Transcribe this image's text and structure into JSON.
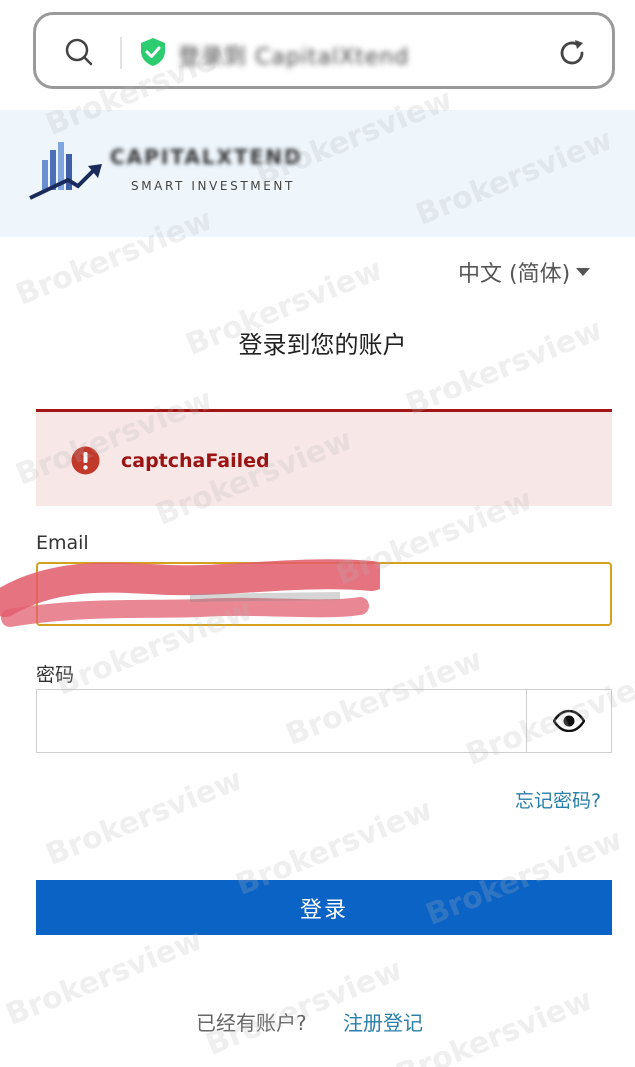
{
  "browser": {
    "url_text": "登录到 CapitalXtend",
    "secure_color": "#2ecc71"
  },
  "brand": {
    "name": "CAPITALXTEND",
    "tagline": "SMART INVESTMENT"
  },
  "language": {
    "selected": "中文 (简体)"
  },
  "page": {
    "title": "登录到您的账户"
  },
  "alert": {
    "message": "captchaFailed",
    "icon": "exclamation-icon",
    "color": "#9b1313"
  },
  "form": {
    "email_label": "Email",
    "email_value": "",
    "password_label": "密码",
    "password_value": "",
    "forgot_link": "忘记密码?",
    "submit_label": "登录"
  },
  "footer": {
    "prompt": "已经有账户?",
    "register_link": "注册登记"
  },
  "watermark": {
    "text": "Brokersview"
  },
  "colors": {
    "primary": "#0b63c6",
    "link": "#2a7fa8",
    "error_bg": "#f8e7e7",
    "focus_border": "#d4a11e"
  }
}
